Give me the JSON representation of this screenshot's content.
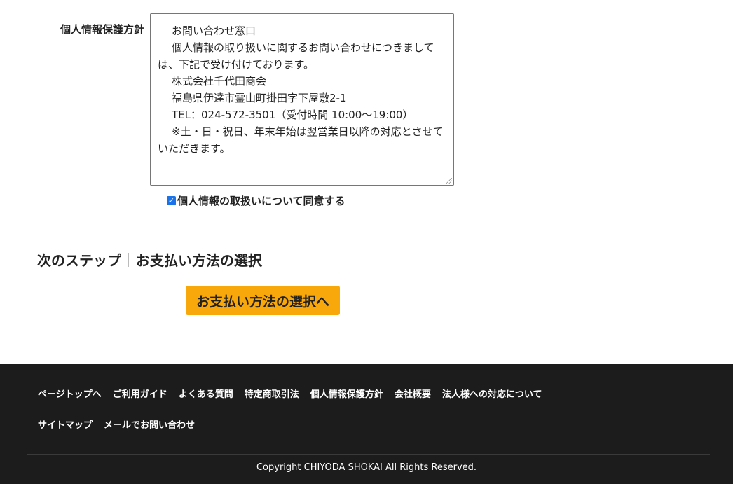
{
  "privacy": {
    "label": "個人情報保護方針",
    "policy_lines": [
      "お問い合わせ窓口",
      "個人情報の取り扱いに関するお問い合わせにつきましては、下記で受け付けております。",
      "株式会社千代田商会",
      "福島県伊達市霊山町掛田字下屋敷2-1",
      "TEL：024-572-3501（受付時間 10:00～19:00）",
      "※土・日・祝日、年末年始は翌営業日以降の対応とさせていただきます。"
    ],
    "agree_checked": true,
    "agree_label": "個人情報の取扱いについて同意する"
  },
  "next_step": {
    "prefix": "次のステップ",
    "title": "お支払い方法の選択"
  },
  "pay_button_label": "お支払い方法の選択へ",
  "footer": {
    "links_row1": [
      "ページトップへ",
      "ご利用ガイド",
      "よくある質問",
      "特定商取引法",
      "個人情報保護方針",
      "会社概要",
      "法人様への対応について"
    ],
    "links_row2": [
      "サイトマップ",
      "メールでお問い合わせ"
    ],
    "copyright": "Copyright CHIYODA SHOKAI All Rights Reserved."
  },
  "colors": {
    "button_accent": "#f8a80b",
    "footer_bg": "#1c1c1c",
    "checkbox_accent": "#1a73e8"
  },
  "icons": {
    "checkbox": "checkmark-icon",
    "resize": "resize-grip-icon"
  }
}
